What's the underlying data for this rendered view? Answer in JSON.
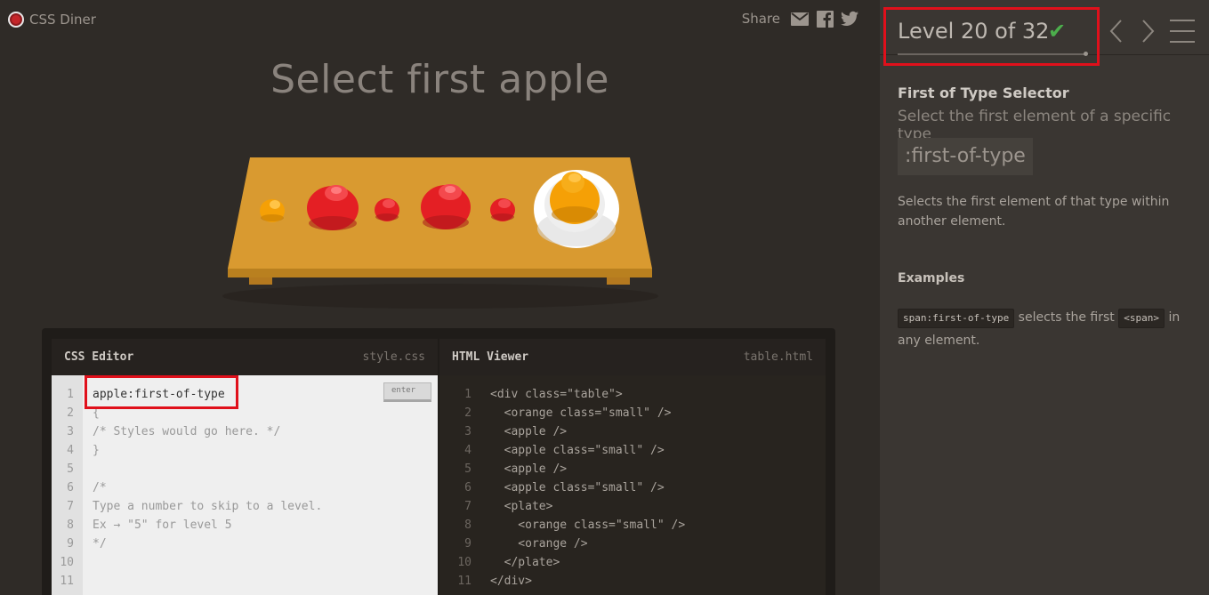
{
  "header": {
    "app_name": "CSS Diner",
    "share_label": "Share",
    "share_icons": [
      "envelope-icon",
      "facebook-icon",
      "twitter-icon"
    ]
  },
  "game": {
    "instruction": "Select first apple",
    "table_items": [
      {
        "type": "orange",
        "size": "small"
      },
      {
        "type": "apple",
        "size": "large"
      },
      {
        "type": "apple",
        "size": "small"
      },
      {
        "type": "apple",
        "size": "large"
      },
      {
        "type": "apple",
        "size": "small"
      },
      {
        "type": "plate",
        "contents": [
          {
            "type": "orange",
            "size": "small"
          },
          {
            "type": "orange",
            "size": "large"
          }
        ]
      }
    ]
  },
  "css_editor": {
    "title": "CSS Editor",
    "filename": "style.css",
    "input_value": "apple:first-of-type",
    "enter_label": "enter",
    "line_numbers": [
      "1",
      "2",
      "3",
      "4",
      "5",
      "6",
      "7",
      "8",
      "9",
      "10",
      "11"
    ],
    "lines": [
      "",
      "{",
      "/* Styles would go here. */",
      "}",
      "",
      "/*",
      "Type a number to skip to a level.",
      "Ex → \"5\" for level 5",
      "*/",
      "",
      ""
    ]
  },
  "html_viewer": {
    "title": "HTML Viewer",
    "filename": "table.html",
    "line_numbers": [
      "1",
      "2",
      "3",
      "4",
      "5",
      "6",
      "7",
      "8",
      "9",
      "10",
      "11"
    ],
    "lines": [
      "<div class=\"table\">",
      "  <orange class=\"small\" />",
      "  <apple />",
      "  <apple class=\"small\" />",
      "  <apple />",
      "  <apple class=\"small\" />",
      "  <plate>",
      "    <orange class=\"small\" />",
      "    <orange />",
      "  </plate>",
      "</div>"
    ]
  },
  "sidebar": {
    "level_label": "Level 20 of 32",
    "level_current": 20,
    "level_total": 32,
    "completed": true,
    "selector_name": "First of Type Selector",
    "selector_description": "Select the first element of a specific type",
    "syntax": ":first-of-type",
    "hint": "Selects the first element of that type within another element.",
    "examples_title": "Examples",
    "example": {
      "code1": "span:first-of-type",
      "text1": " selects the first ",
      "code2": "<span>",
      "text2": " in any element."
    }
  },
  "colors": {
    "background": "#2f2b27",
    "sidebar": "#3a3632",
    "table": "#d99a30",
    "apple": "#e41f24",
    "orange": "#f5a006",
    "plate": "#ffffff",
    "check": "#4cae4c",
    "highlight": "#e0101b"
  }
}
